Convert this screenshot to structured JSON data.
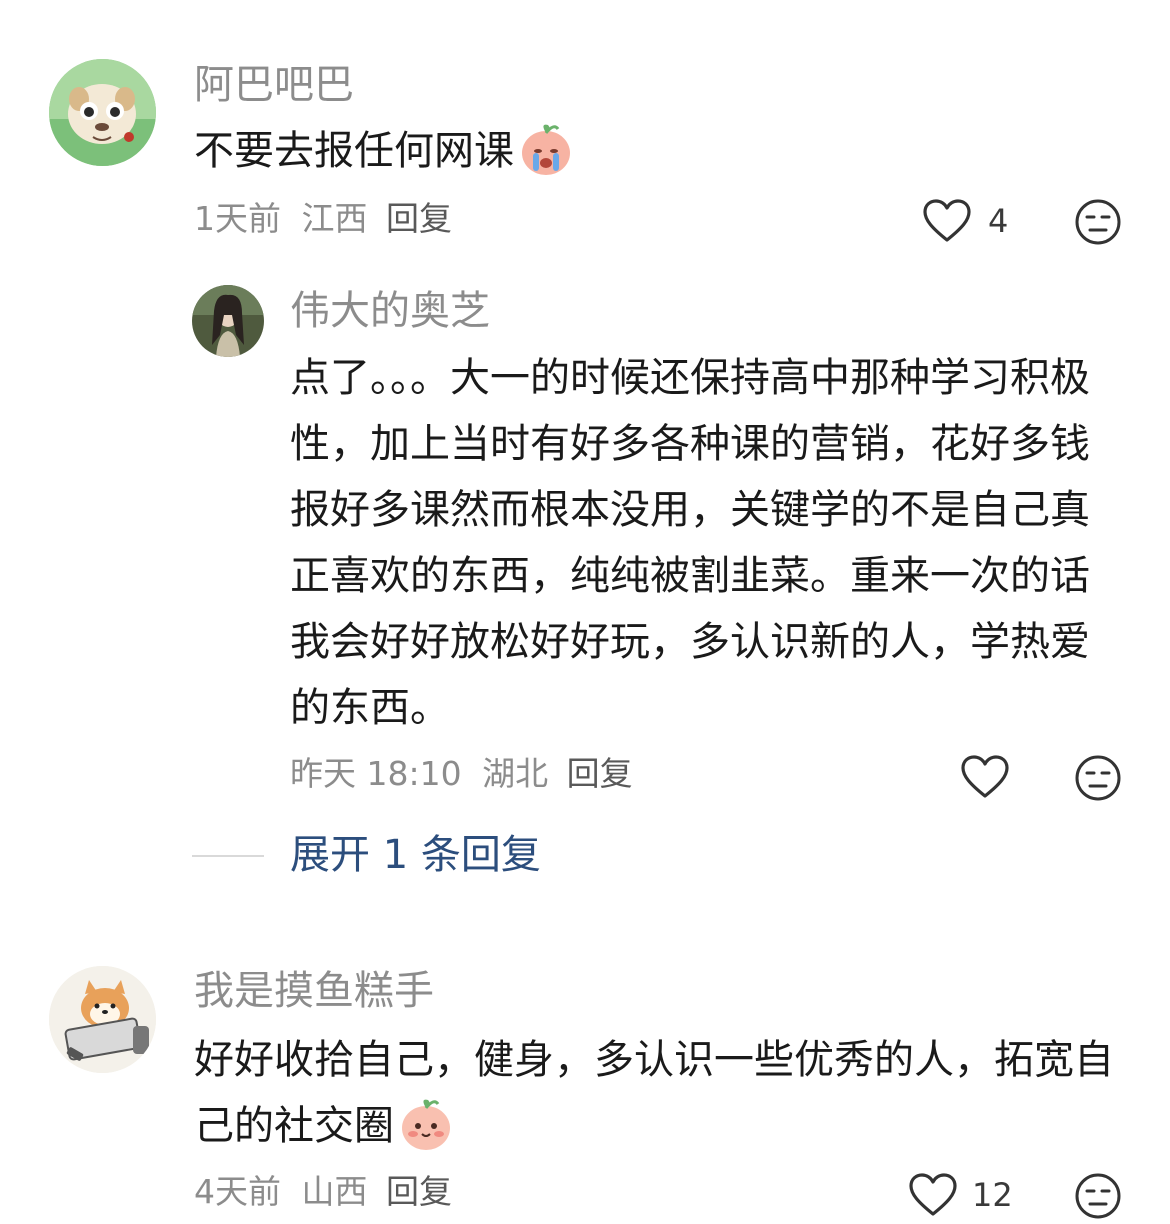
{
  "comments": [
    {
      "username": "阿巴吧巴",
      "text": "不要去报任何网课",
      "emoji": "crying-peach-emoji",
      "time": "1天前",
      "location": "江西",
      "reply_label": "回复",
      "likes": "4"
    },
    {
      "username": "伟大的奥芝",
      "text": "点了。。。大一的时候还保持高中那种学习积极性，加上当时有好多各种课的营销，花好多钱报好多课然而根本没用，关键学的不是自己真正喜欢的东西，纯纯被割韭菜。重来一次的话我会好好放松好好玩，多认识新的人，学热爱的东西。",
      "time": "昨天 18:10",
      "location": "湖北",
      "reply_label": "回复",
      "likes": ""
    },
    {
      "username": "我是摸鱼糕手",
      "text": "好好收拾自己，健身，多认识一些优秀的人，拓宽自己的社交圈",
      "emoji": "shy-peach-emoji",
      "time": "4天前",
      "location": "山西",
      "reply_label": "回复",
      "likes": "12"
    }
  ],
  "expand_replies": "展开 1 条回复",
  "colors": {
    "username": "#8c8c8c",
    "text": "#1a1a1a",
    "expand_link": "#2c4e7d",
    "meta": "#8c8c8c"
  }
}
